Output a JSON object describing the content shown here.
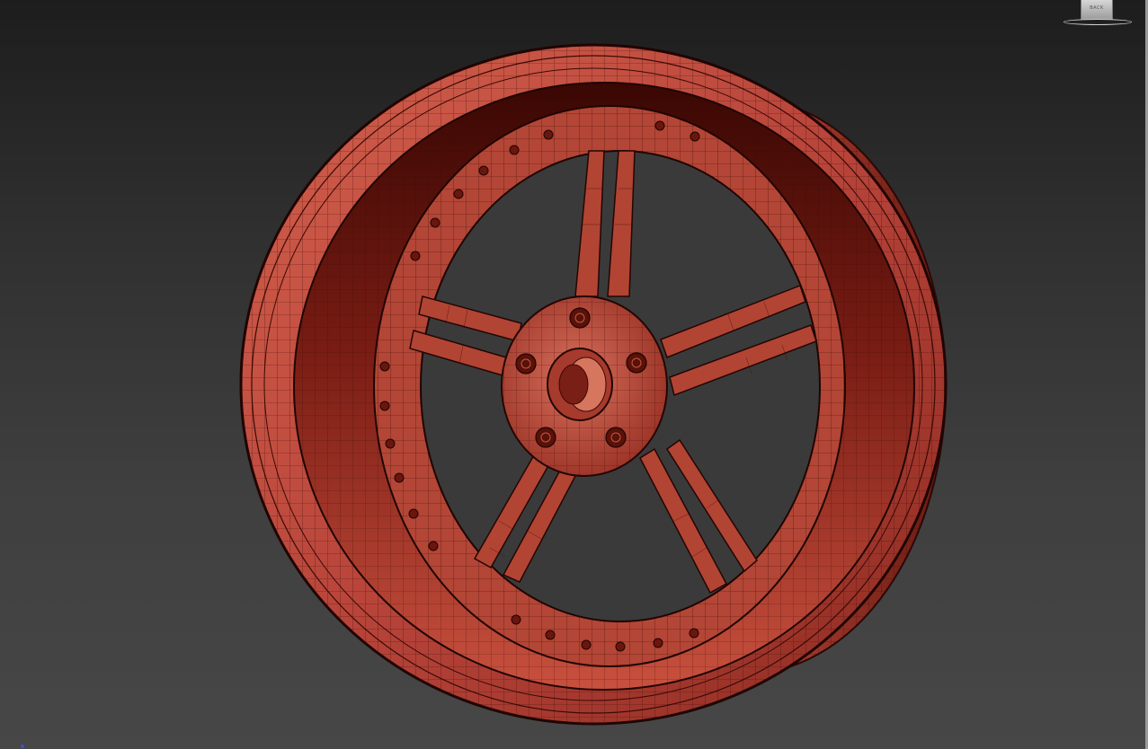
{
  "viewport": {
    "background_top": "#1d1d1d",
    "background_bottom": "#474747"
  },
  "viewcube": {
    "face_label": "BACK"
  },
  "model": {
    "name_icon": "wheel-rim-wireframe",
    "base_color": "#b04030",
    "edge_color": "#2a0806",
    "shade_color": "#5a1108",
    "spoke_count": 5,
    "lug_count": 5
  }
}
